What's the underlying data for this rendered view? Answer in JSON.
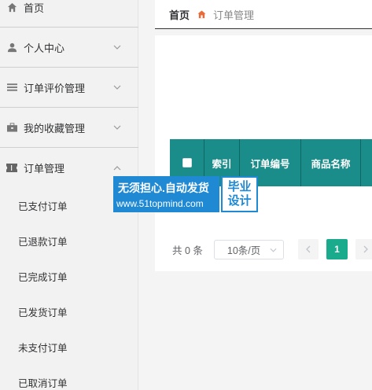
{
  "sidebar": {
    "items": [
      {
        "label": "首页",
        "icon": "home-icon"
      },
      {
        "label": "个人中心",
        "icon": "user-icon"
      },
      {
        "label": "订单评价管理",
        "icon": "list-icon"
      },
      {
        "label": "我的收藏管理",
        "icon": "briefcase-icon"
      },
      {
        "label": "订单管理",
        "icon": "ticket-icon",
        "expanded": true
      }
    ],
    "sub_items": [
      "已支付订单",
      "已退款订单",
      "已完成订单",
      "已发货订单",
      "未支付订单",
      "已取消订单"
    ]
  },
  "breadcrumb": {
    "home": "首页",
    "current": "订单管理"
  },
  "table": {
    "headers": [
      "索引",
      "订单编号",
      "商品名称"
    ],
    "header_color": "#1a8c89"
  },
  "pagination": {
    "total_text": "共 0 条",
    "page_size": "10条/页",
    "current_page": "1",
    "accent_color": "#1aaa8c"
  },
  "watermark": {
    "line1": "无须担心.自动发货",
    "line2": "www.51topmind.com",
    "badge_line1": "毕业",
    "badge_line2": "设计"
  }
}
